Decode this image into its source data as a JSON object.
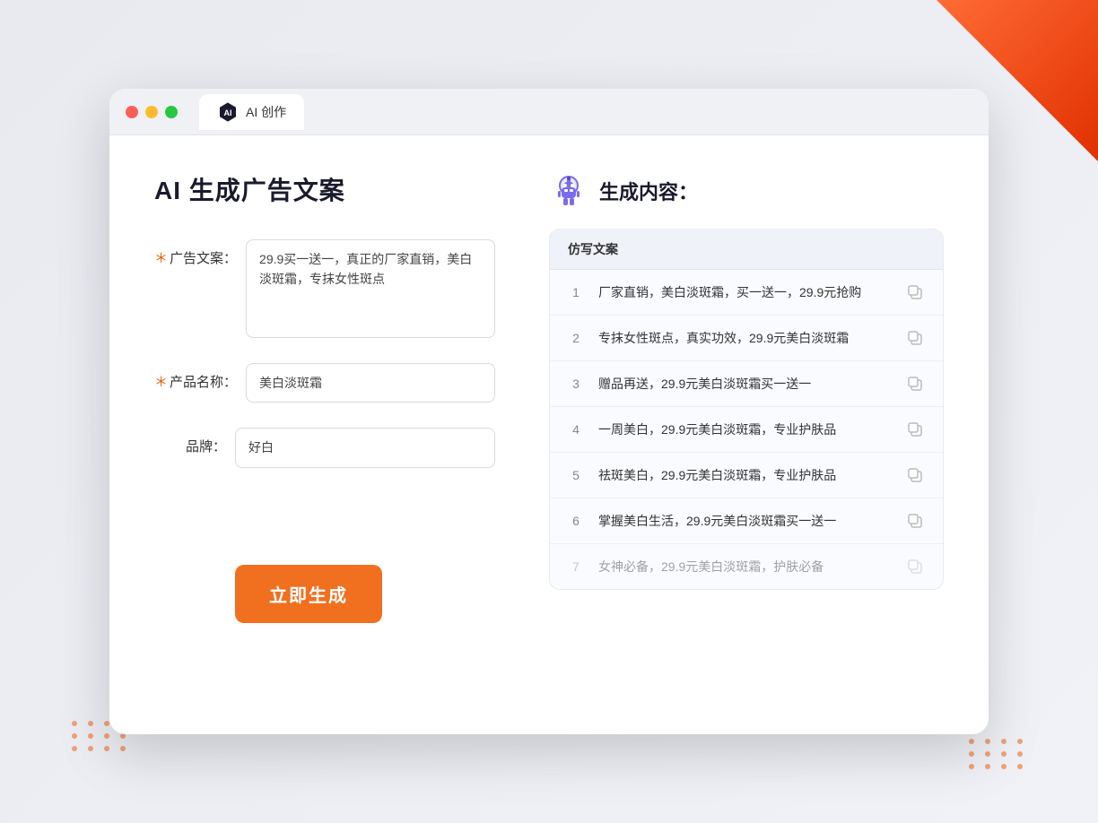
{
  "window": {
    "tab_label": "AI 创作"
  },
  "header": {
    "title": "AI 生成广告文案"
  },
  "form": {
    "ad_copy_label": "广告文案：",
    "ad_copy_required": "＊",
    "ad_copy_value": "29.9买一送一，真正的厂家直销，美白淡斑霜，专抹女性斑点",
    "product_name_label": "产品名称：",
    "product_name_required": "＊",
    "product_name_value": "美白淡斑霜",
    "brand_label": "品牌：",
    "brand_value": "好白",
    "generate_button": "立即生成"
  },
  "result": {
    "title": "生成内容：",
    "column_header": "仿写文案",
    "items": [
      {
        "num": "1",
        "text": "厂家直销，美白淡斑霜，买一送一，29.9元抢购",
        "faded": false
      },
      {
        "num": "2",
        "text": "专抹女性斑点，真实功效，29.9元美白淡斑霜",
        "faded": false
      },
      {
        "num": "3",
        "text": "赠品再送，29.9元美白淡斑霜买一送一",
        "faded": false
      },
      {
        "num": "4",
        "text": "一周美白，29.9元美白淡斑霜，专业护肤品",
        "faded": false
      },
      {
        "num": "5",
        "text": "祛斑美白，29.9元美白淡斑霜，专业护肤品",
        "faded": false
      },
      {
        "num": "6",
        "text": "掌握美白生活，29.9元美白淡斑霜买一送一",
        "faded": false
      },
      {
        "num": "7",
        "text": "女神必备，29.9元美白淡斑霜，护肤必备",
        "faded": true
      }
    ]
  }
}
